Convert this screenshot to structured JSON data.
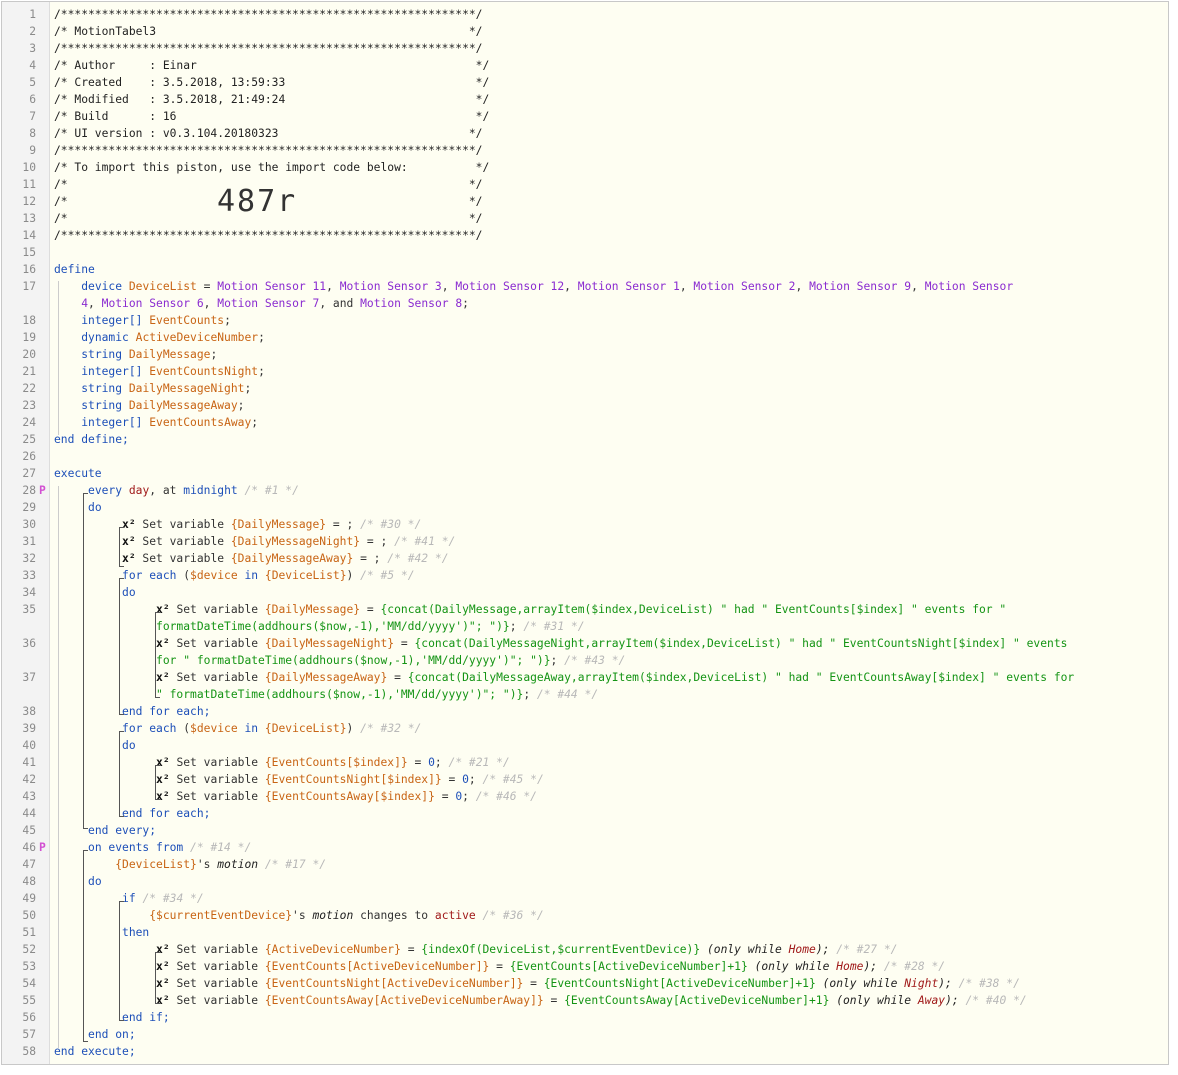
{
  "header": {
    "stars": "/*************************************************************/",
    "title_line": "/* MotionTabel3                                              */",
    "author_line": "/* Author     : Einar                                         */",
    "created_line": "/* Created    : 3.5.2018, 13:59:33                            */",
    "modified_line": "/* Modified   : 3.5.2018, 21:49:24                            */",
    "build_line": "/* Build      : 16                                            */",
    "ui_line": "/* UI version : v0.3.104.20180323                            */",
    "import_line": "/* To import this piston, use the import code below:          */",
    "blank_line": "/*                                                           */",
    "import_code": "487r"
  },
  "code": {
    "define": "define",
    "end_define": "end define;",
    "execute": "execute",
    "end_execute": "end execute;",
    "device_kw": "device",
    "device_list_name": "DeviceList",
    "device_line1_devices": [
      "Motion Sensor 11",
      "Motion Sensor 3",
      "Motion Sensor 12",
      "Motion Sensor 1",
      "Motion Sensor 2",
      "Motion Sensor 9",
      "Motion Sensor"
    ],
    "device_line2_devices": [
      "4",
      "Motion Sensor 6",
      "Motion Sensor 7",
      "Motion Sensor 8"
    ],
    "and_word": "and",
    "vars": [
      {
        "type": "integer[]",
        "name": "EventCounts"
      },
      {
        "type": "dynamic",
        "name": "ActiveDeviceNumber"
      },
      {
        "type": "string",
        "name": "DailyMessage"
      },
      {
        "type": "integer[]",
        "name": "EventCountsNight"
      },
      {
        "type": "string",
        "name": "DailyMessageNight"
      },
      {
        "type": "string",
        "name": "DailyMessageAway"
      },
      {
        "type": "integer[]",
        "name": "EventCountsAway"
      }
    ],
    "every_line": [
      "every",
      "day",
      "at",
      "midnight",
      "/* #1 */"
    ],
    "do": "do",
    "end_every": "end every;",
    "set_variable": "Set variable",
    "x2": "x²",
    "set_empty": [
      {
        "var": "{DailyMessage}",
        "comment": "/* #30 */"
      },
      {
        "var": "{DailyMessageNight}",
        "comment": "/* #41 */"
      },
      {
        "var": "{DailyMessageAway}",
        "comment": "/* #42 */"
      }
    ],
    "for_each_1": {
      "device": "$device",
      "list": "{DeviceList}",
      "comment": "/* #5 */"
    },
    "for_each_2": {
      "device": "$device",
      "list": "{DeviceList}",
      "comment": "/* #32 */"
    },
    "end_for_each": "end for each;",
    "concat_lines": {
      "l35a_var": "{DailyMessage}",
      "l35a_expr": "{concat(DailyMessage,arrayItem($index,DeviceList) \" had \" EventCounts[$index] \" events for \"",
      "l35b_expr": "formatDateTime(addhours($now,-1),'MM/dd/yyyy')\"; \")}",
      "l35_comment": "/* #31 */",
      "l36a_var": "{DailyMessageNight}",
      "l36a_expr": "{concat(DailyMessageNight,arrayItem($index,DeviceList) \" had \" EventCountsNight[$index] \" events",
      "l36b_expr": "for \" formatDateTime(addhours($now,-1),'MM/dd/yyyy')\"; \")}",
      "l36_comment": "/* #43 */",
      "l37a_var": "{DailyMessageAway}",
      "l37a_expr": "{concat(DailyMessageAway,arrayItem($index,DeviceList) \" had \" EventCountsAway[$index] \" events for",
      "l37b_expr": "\" formatDateTime(addhours($now,-1),'MM/dd/yyyy')\"; \")}",
      "l37_comment": "/* #44 */"
    },
    "zero_sets": [
      {
        "var": "{EventCounts[$index]}",
        "value": "0",
        "comment": "/* #21 */"
      },
      {
        "var": "{EventCountsNight[$index]}",
        "value": "0",
        "comment": "/* #45 */"
      },
      {
        "var": "{EventCountsAway[$index]}",
        "value": "0",
        "comment": "/* #46 */"
      }
    ],
    "on_events": {
      "kw": "on events from",
      "comment": "/* #14 */",
      "list": "{DeviceList}",
      "possessive": "'s",
      "attr": "motion",
      "comment2": "/* #17 */"
    },
    "if_block": {
      "kw": "if",
      "comment": "/* #34 */",
      "device": "{$currentEventDevice}",
      "attr": "motion",
      "changes": "changes to",
      "value": "active",
      "comment2": "/* #36 */",
      "then": "then",
      "end_if": "end if;"
    },
    "then_sets": [
      {
        "var": "{ActiveDeviceNumber}",
        "expr": "{indexOf(DeviceList,$currentEventDevice)}",
        "only": "(only while",
        "mode": "Home",
        "comment": "/* #27 */"
      },
      {
        "var": "{EventCounts[ActiveDeviceNumber]}",
        "expr": "{EventCounts[ActiveDeviceNumber]+1}",
        "only": "(only while",
        "mode": "Home",
        "comment": "/* #28 */"
      },
      {
        "var": "{EventCountsNight[ActiveDeviceNumber]}",
        "expr": "{EventCountsNight[ActiveDeviceNumber]+1}",
        "only": "(only while",
        "mode": "Night",
        "comment": "/* #38 */"
      },
      {
        "var": "{EventCountsAway[ActiveDeviceNumberAway]}",
        "expr": "{EventCountsAway[ActiveDeviceNumber]+1}",
        "only": "(only while",
        "mode": "Away",
        "comment": "/* #40 */"
      }
    ],
    "end_on": "end on;"
  },
  "markers": {
    "line28": "P",
    "line46": "P"
  }
}
